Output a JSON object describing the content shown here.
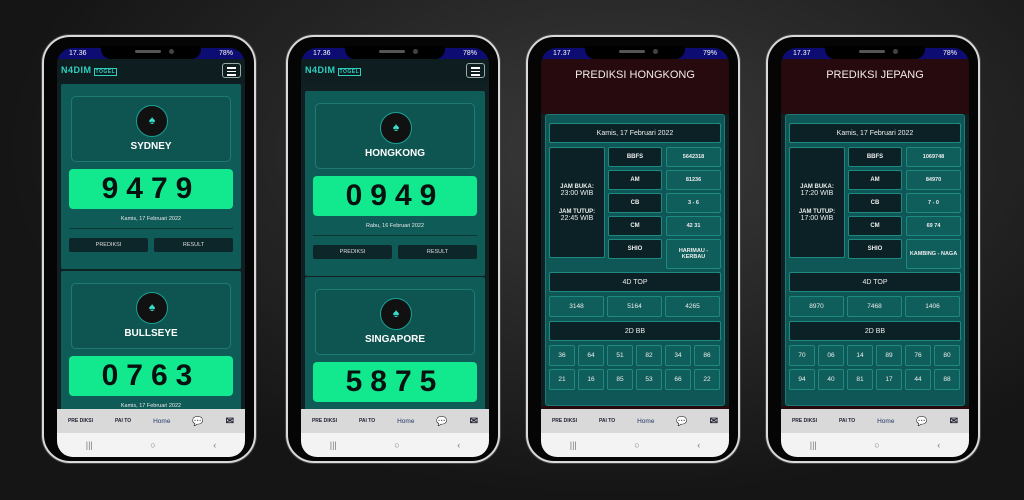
{
  "phones": [
    {
      "status": {
        "time": "17.36",
        "battery": "78%"
      },
      "type": "home",
      "brand": "N4DIM",
      "brand_sub": "TOGEL",
      "cards": [
        {
          "name": "SYDNEY",
          "number": "9479",
          "date": "Kamis, 17 Februari 2022",
          "prediksi": "PREDIKSI",
          "result": "RESULT"
        },
        {
          "name": "BULLSEYE",
          "number": "0763",
          "date": "Kamis, 17 Februari 2022"
        }
      ]
    },
    {
      "status": {
        "time": "17.36",
        "battery": "78%"
      },
      "type": "home",
      "brand": "N4DIM",
      "brand_sub": "TOGEL",
      "cards": [
        {
          "name": "HONGKONG",
          "number": "0949",
          "date": "Rabu, 16 Februari 2022",
          "prediksi": "PREDIKSI",
          "result": "RESULT"
        },
        {
          "name": "SINGAPORE",
          "number": "5875"
        }
      ]
    },
    {
      "status": {
        "time": "17.37",
        "battery": "79%"
      },
      "type": "prediksi",
      "title": "PREDIKSI HONGKONG",
      "date": "Kamis, 17 Februari 2022",
      "jam_buka_label": "JAM BUKA:",
      "jam_buka": "23:00 WIB",
      "jam_tutup_label": "JAM TUTUP:",
      "jam_tutup": "22:45 WIB",
      "rows": [
        {
          "label": "BBFS",
          "value": "5642318"
        },
        {
          "label": "AM",
          "value": "81236"
        },
        {
          "label": "CB",
          "value": "3 - 6"
        },
        {
          "label": "CM",
          "value": "42 31"
        },
        {
          "label": "SHIO",
          "value": "HARIMAU - KERBAU"
        }
      ],
      "top4d_label": "4D TOP",
      "top4d": [
        "3148",
        "5164",
        "4265"
      ],
      "bb2d_label": "2D BB",
      "bb2d": [
        "36",
        "64",
        "51",
        "82",
        "34",
        "86",
        "21",
        "16",
        "85",
        "53",
        "66",
        "22"
      ]
    },
    {
      "status": {
        "time": "17.37",
        "battery": "78%"
      },
      "type": "prediksi",
      "title": "PREDIKSI JEPANG",
      "date": "Kamis, 17 Februari 2022",
      "jam_buka_label": "JAM BUKA:",
      "jam_buka": "17:20 WIB",
      "jam_tutup_label": "JAM TUTUP:",
      "jam_tutup": "17:00 WIB",
      "rows": [
        {
          "label": "BBFS",
          "value": "1069748"
        },
        {
          "label": "AM",
          "value": "84970"
        },
        {
          "label": "CB",
          "value": "7 - 0"
        },
        {
          "label": "CM",
          "value": "69 74"
        },
        {
          "label": "SHIO",
          "value": "KAMBING - NAGA"
        }
      ],
      "top4d_label": "4D TOP",
      "top4d": [
        "8970",
        "7468",
        "1406"
      ],
      "bb2d_label": "2D BB",
      "bb2d": [
        "70",
        "06",
        "14",
        "89",
        "76",
        "80",
        "94",
        "40",
        "81",
        "17",
        "44",
        "88"
      ]
    }
  ],
  "bottom_nav": {
    "prediksi": "PRE DIKSI",
    "paito": "PAI TO",
    "home": "Home",
    "chat_icon": "chat-bubble-icon",
    "mail_icon": "mail-icon"
  },
  "system_nav": {
    "recents": "|||",
    "home": "○",
    "back": "‹"
  },
  "colors": {
    "accent_green": "#12e98e",
    "teal": "#0f5b57",
    "maroon": "#260a0e",
    "status_bar": "#0c0c72"
  }
}
